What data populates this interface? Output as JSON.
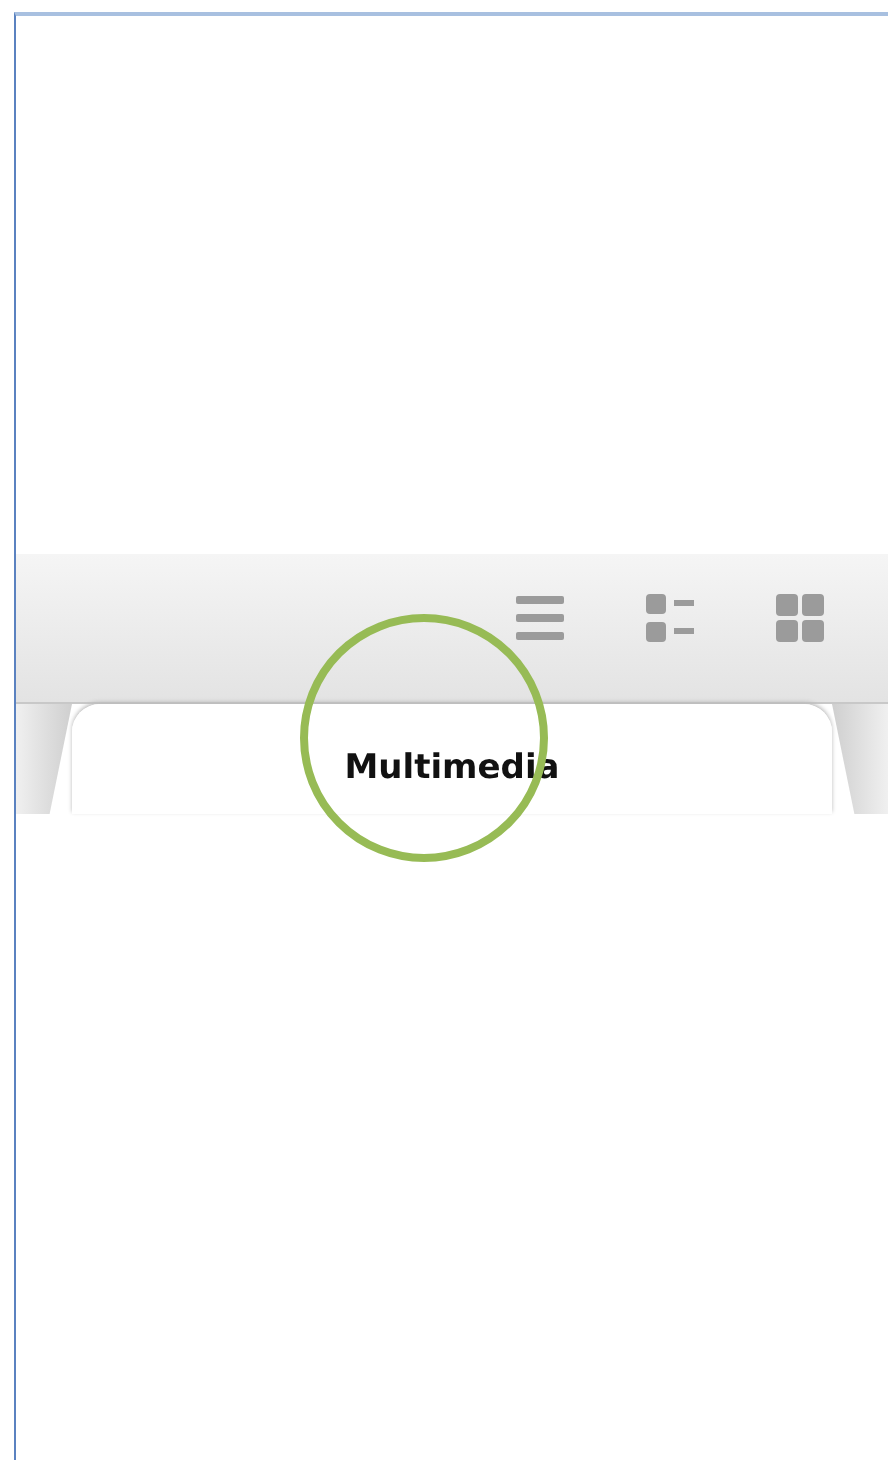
{
  "toolbar": {
    "view_options": [
      {
        "kind": "list"
      },
      {
        "kind": "compact"
      },
      {
        "kind": "grid"
      }
    ]
  },
  "tabs": [
    {
      "kind": "partial",
      "selected": false
    },
    {
      "kind": "full",
      "label": "Multimedia",
      "selected": true
    },
    {
      "kind": "partial",
      "selected": false
    }
  ],
  "highlight": {
    "kind": "circle"
  }
}
